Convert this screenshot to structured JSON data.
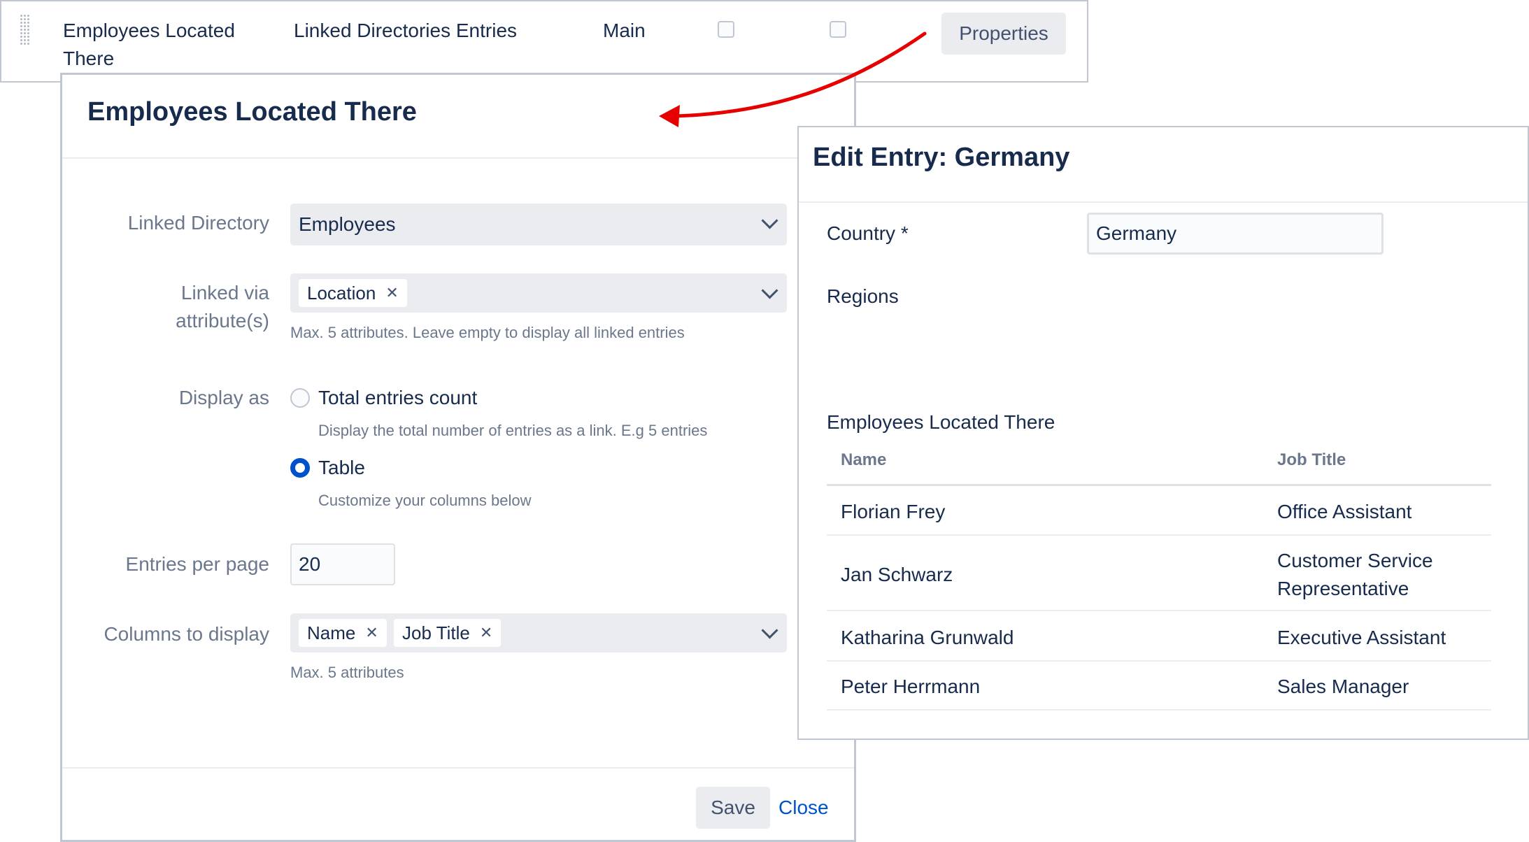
{
  "attribute_row": {
    "name": "Employees Located There",
    "type": "Linked Directories Entries",
    "group": "Main",
    "properties_label": "Properties"
  },
  "properties_dialog": {
    "title": "Employees Located There",
    "linked_directory": {
      "label": "Linked Directory",
      "value": "Employees"
    },
    "linked_via": {
      "label": "Linked via attribute(s)",
      "tags": [
        "Location"
      ],
      "help": "Max. 5 attributes. Leave empty to display all linked entries"
    },
    "display_as": {
      "label": "Display as",
      "options": [
        {
          "label": "Total entries count",
          "help": "Display the total number of entries as a link. E.g 5 entries",
          "checked": false
        },
        {
          "label": "Table",
          "help": "Customize your columns below",
          "checked": true
        }
      ]
    },
    "entries_per_page": {
      "label": "Entries per page",
      "value": "20"
    },
    "columns_to_display": {
      "label": "Columns to display",
      "tags": [
        "Name",
        "Job Title"
      ],
      "help": "Max. 5 attributes"
    },
    "save_label": "Save",
    "close_label": "Close"
  },
  "edit_entry_dialog": {
    "title": "Edit Entry: Germany",
    "country_label": "Country *",
    "country_value": "Germany",
    "regions_label": "Regions",
    "section_label": "Employees Located There",
    "table": {
      "headers": [
        "Name",
        "Job Title"
      ],
      "rows": [
        [
          "Florian Frey",
          "Office Assistant"
        ],
        [
          "Jan Schwarz",
          "Customer Service Representative"
        ],
        [
          "Katharina Grunwald",
          "Executive Assistant"
        ],
        [
          "Peter Herrmann",
          "Sales Manager"
        ]
      ]
    }
  },
  "colors": {
    "accent": "#0052cc",
    "arrow": "#e60000",
    "text": "#172b4d",
    "muted": "#6b778c"
  },
  "icons": [
    "drag-handle-icon",
    "chevron-down-icon",
    "remove-tag-icon",
    "arrow-icon"
  ]
}
